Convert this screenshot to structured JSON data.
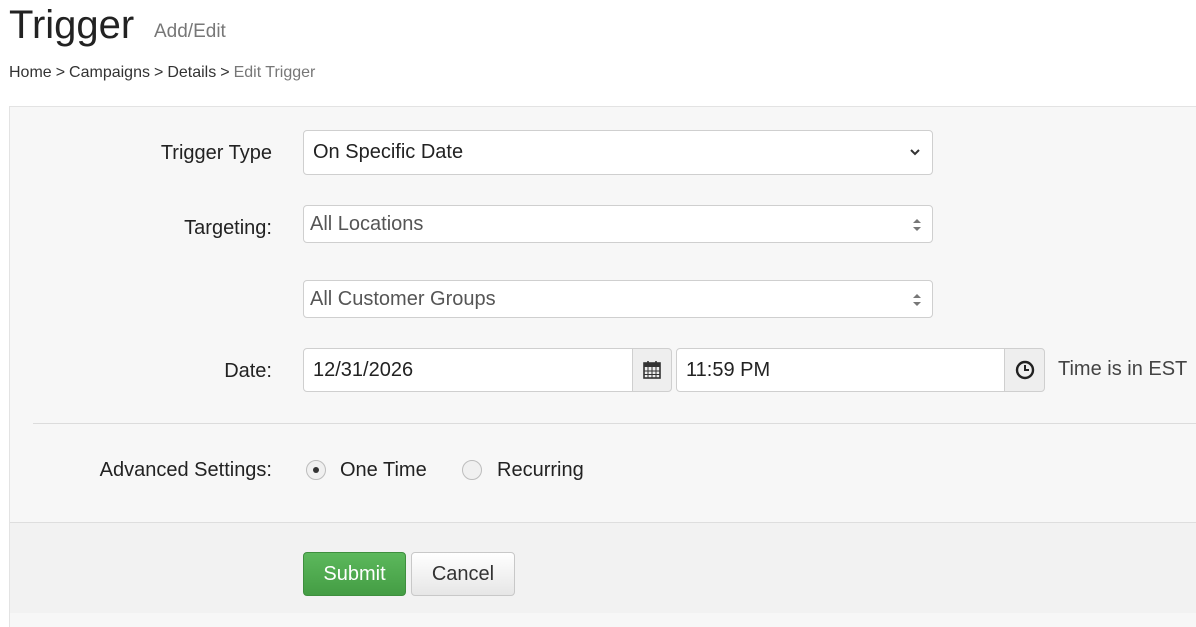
{
  "header": {
    "title": "Trigger",
    "subtitle": "Add/Edit"
  },
  "breadcrumb": {
    "items": [
      "Home",
      "Campaigns",
      "Details"
    ],
    "separator": ">",
    "current": "Edit Trigger"
  },
  "form": {
    "trigger_type": {
      "label": "Trigger Type",
      "value": "On Specific Date"
    },
    "targeting": {
      "label": "Targeting:",
      "locations_value": "All Locations",
      "customer_groups_value": "All Customer Groups"
    },
    "date": {
      "label": "Date:",
      "date_value": "12/31/2026",
      "date_icon": "calendar-icon",
      "time_value": "11:59 PM",
      "time_icon": "clock-icon",
      "timezone_note": "Time is in EST"
    },
    "advanced": {
      "label": "Advanced Settings:",
      "options": [
        {
          "label": "One Time",
          "checked": true
        },
        {
          "label": "Recurring",
          "checked": false
        }
      ]
    }
  },
  "actions": {
    "submit_label": "Submit",
    "cancel_label": "Cancel"
  },
  "colors": {
    "submit_bg": "#5cb85c",
    "panel_bg": "#f7f7f7"
  }
}
